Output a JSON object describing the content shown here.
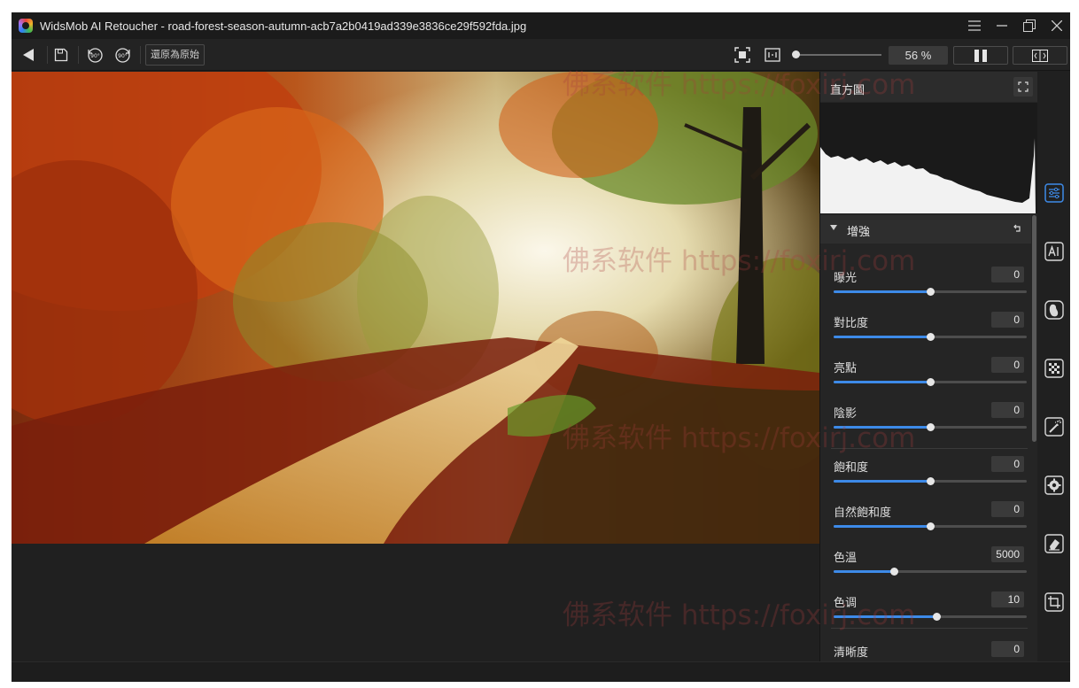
{
  "window": {
    "title": "WidsMob AI Retoucher - road-forest-season-autumn-acb7a2b0419ad339e3836ce29f592fda.jpg",
    "controls": [
      "menu-icon",
      "minimize-icon",
      "maximize-icon",
      "close-icon"
    ]
  },
  "toolbar": {
    "reset_label": "還原為原始",
    "zoom_value": "56 %",
    "zoom_fraction": 0.02,
    "icons": [
      "back-arrow-icon",
      "save-icon",
      "rotate-left-90-icon",
      "rotate-right-90-icon",
      "fit-screen-icon",
      "actual-size-icon",
      "single-view-icon",
      "split-view-icon"
    ]
  },
  "panel": {
    "histogram_title": "直方圖",
    "section_title": "增強",
    "controls": [
      {
        "label": "曝光",
        "value": "0",
        "fraction": 0.5
      },
      {
        "label": "對比度",
        "value": "0",
        "fraction": 0.5
      },
      {
        "label": "亮點",
        "value": "0",
        "fraction": 0.5
      },
      {
        "label": "陰影",
        "value": "0",
        "fraction": 0.5
      },
      {
        "label": "飽和度",
        "value": "0",
        "fraction": 0.5
      },
      {
        "label": "自然飽和度",
        "value": "0",
        "fraction": 0.5
      },
      {
        "label": "色溫",
        "value": "5000",
        "fraction": 0.31
      },
      {
        "label": "色调",
        "value": "10",
        "fraction": 0.53
      },
      {
        "label": "清晰度",
        "value": "0"
      }
    ]
  },
  "rail": {
    "icons": [
      "adjustments-icon",
      "ai-icon",
      "portrait-icon",
      "noise-icon",
      "magic-wand-icon",
      "gear-icon",
      "eraser-icon",
      "crop-icon"
    ]
  },
  "watermark": {
    "text": "佛系软件 https://foxirj.com"
  },
  "colors": {
    "accent": "#3d8ae8",
    "background": "#202020",
    "panel": "#252525"
  }
}
